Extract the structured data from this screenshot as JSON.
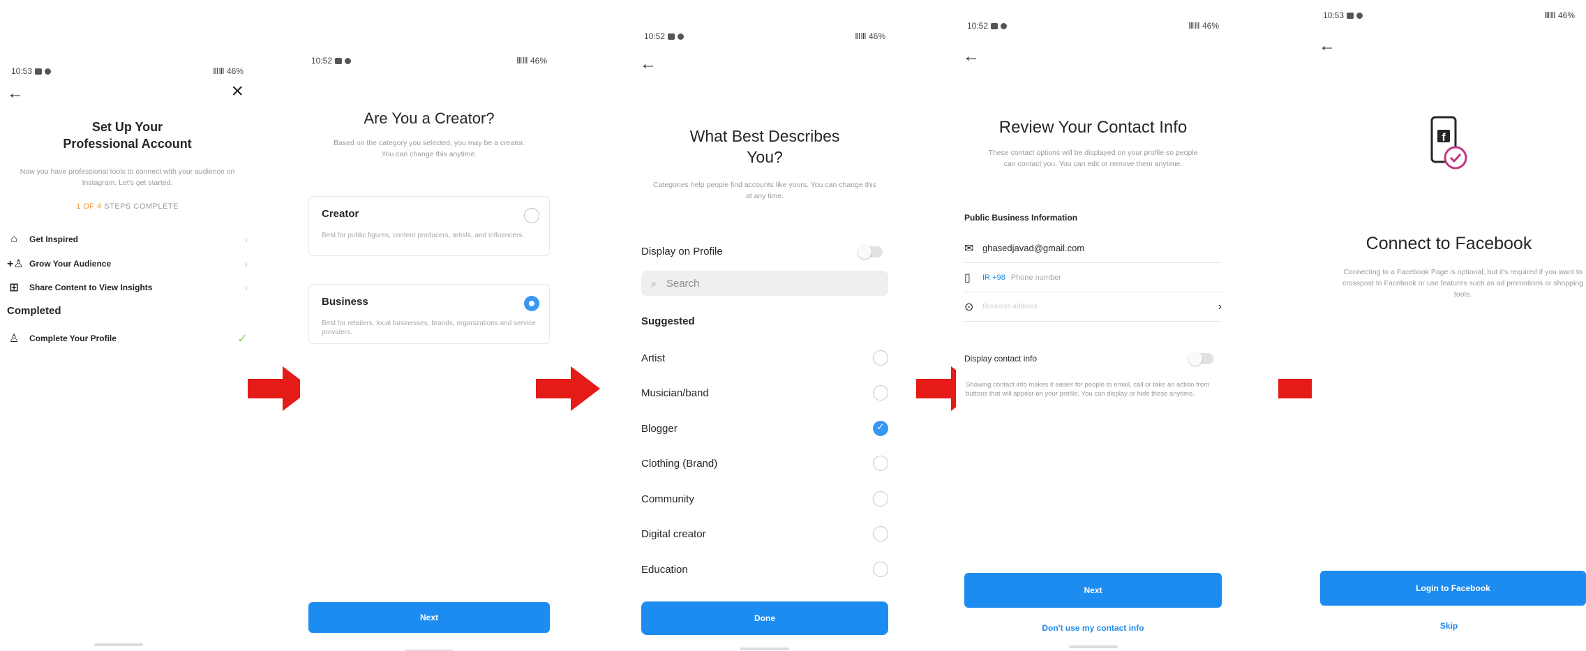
{
  "status": {
    "time_1": "10:53",
    "time_2": "10:52",
    "time_3": "10:52",
    "time_4": "10:52",
    "time_5": "10:53",
    "right": "ⅢⅢ 46%"
  },
  "screen1": {
    "title_line1": "Set Up Your",
    "title_line2": "Professional Account",
    "subtitle": "Now you have professional tools to connect with your audience on Instagram. Let's get started.",
    "steps_prefix": "1 OF 4",
    "steps_suffix": " STEPS COMPLETE",
    "items": [
      {
        "label": "Get Inspired",
        "icon": "storefront-icon"
      },
      {
        "label": "Grow Your Audience",
        "icon": "add-person-icon"
      },
      {
        "label": "Share Content to View Insights",
        "icon": "plus-square-icon"
      }
    ],
    "completed_heading": "Completed",
    "completed_item": "Complete Your Profile"
  },
  "screen2": {
    "title": "Are You a Creator?",
    "subtitle": "Based on the category you selected, you may be a creator. You can change this anytime.",
    "options": [
      {
        "title": "Creator",
        "desc": "Best for public figures, content producers, artists, and influencers.",
        "selected": false
      },
      {
        "title": "Business",
        "desc": "Best for retailers, local businesses, brands, organizations and service providers.",
        "selected": true
      }
    ],
    "next_label": "Next"
  },
  "screen3": {
    "title_line1": "What Best Describes",
    "title_line2": "You?",
    "subtitle": "Categories help people find accounts like yours. You can change this at any time.",
    "display_on_profile": "Display on Profile",
    "search_placeholder": "Search",
    "suggested": "Suggested",
    "categories": [
      {
        "label": "Artist",
        "selected": false
      },
      {
        "label": "Musician/band",
        "selected": false
      },
      {
        "label": "Blogger",
        "selected": true
      },
      {
        "label": "Clothing (Brand)",
        "selected": false
      },
      {
        "label": "Community",
        "selected": false
      },
      {
        "label": "Digital creator",
        "selected": false
      },
      {
        "label": "Education",
        "selected": false
      }
    ],
    "done_label": "Done"
  },
  "screen4": {
    "title": "Review Your Contact Info",
    "subtitle": "These contact options will be displayed on your profile so people can contact you. You can edit or remove them anytime.",
    "section": "Public Business Information",
    "email": "ghasedjavad@gmail.com",
    "phone_code": "IR +98",
    "phone_placeholder": "Phone number",
    "address_placeholder": "Business address",
    "display_contact_info": "Display contact info",
    "contact_desc": "Showing contact info makes it easier for people to email, call or take an action from buttons that will appear on your profile. You can display or hide these anytime.",
    "next_label": "Next",
    "dont_use_label": "Don't use my contact info"
  },
  "screen5": {
    "title": "Connect to Facebook",
    "subtitle": "Connecting to a Facebook Page is optional, but it's required if you want to crosspost to Facebook or use features such as ad promotions or shopping tools.",
    "login_label": "Login to Facebook",
    "skip_label": "Skip"
  },
  "colors": {
    "primary_blue": "#1d8cf1",
    "arrow_red": "#e41b17",
    "step_orange": "#f09433",
    "check_green": "#9bd46a"
  }
}
